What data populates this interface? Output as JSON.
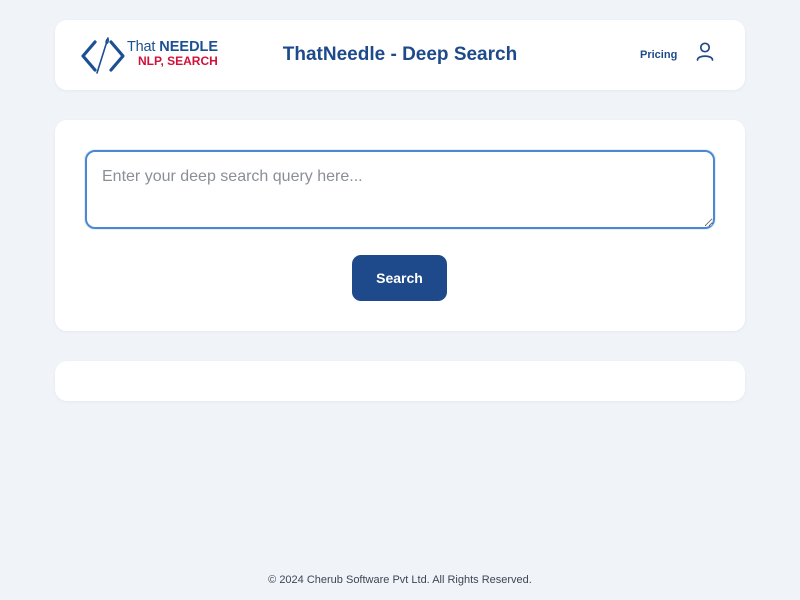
{
  "header": {
    "logo": {
      "line1_a": "That",
      "line1_b": "NEEDLE",
      "line2": "NLP, SEARCH",
      "icon": "code-needle-icon"
    },
    "title": "ThatNeedle - Deep Search",
    "nav": {
      "pricing_label": "Pricing",
      "user_icon": "user-icon"
    }
  },
  "search": {
    "query_value": "",
    "placeholder": "Enter your deep search query here...",
    "button_label": "Search"
  },
  "results": {
    "items": []
  },
  "footer": {
    "copyright": "© 2024 Cherub Software Pvt Ltd. All Rights Reserved."
  },
  "colors": {
    "background": "#f0f4f9",
    "brand_blue": "#1e4a8b",
    "brand_red": "#d0113a",
    "input_border": "#4a89d2",
    "card": "#ffffff"
  }
}
